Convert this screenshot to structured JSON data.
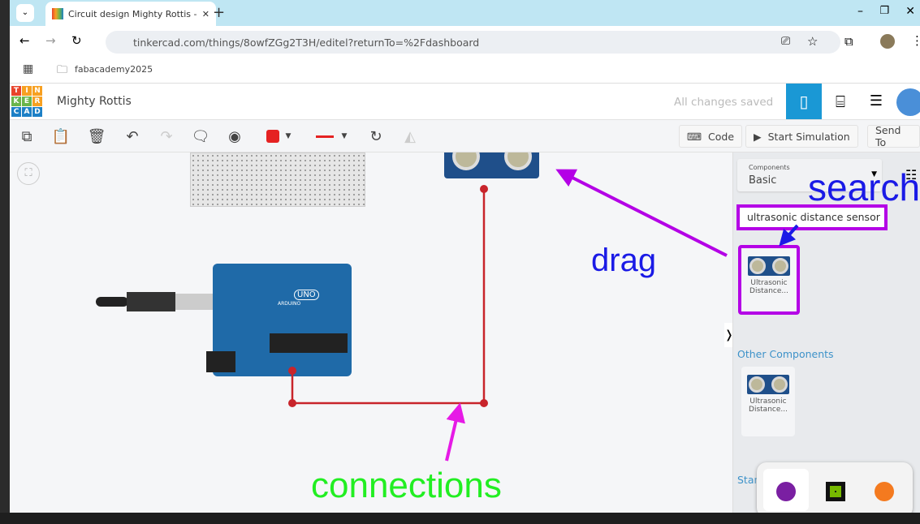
{
  "browser": {
    "tab_title": "Circuit design Mighty Rottis - Ti",
    "url": "tinkercad.com/things/8owfZGg2T3H/editel?returnTo=%2Fdashboard",
    "bookmark": "fabacademy2025"
  },
  "app": {
    "logo": [
      "T",
      "I",
      "N",
      "K",
      "E",
      "R",
      "C",
      "A",
      "D"
    ],
    "project_name": "Mighty Rottis",
    "save_status": "All changes saved"
  },
  "toolbar": {
    "code_label": "Code",
    "start_sim_label": "Start Simulation",
    "send_to_label": "Send To",
    "color": "#e52222"
  },
  "panel": {
    "components_label": "Components",
    "components_value": "Basic",
    "search_value": "ultrasonic distance sensor",
    "result_label_1": "Ultrasonic",
    "result_label_2": "Distance...",
    "other_heading": "Other Components",
    "other_label_1": "Ultrasonic",
    "other_label_2": "Distance...",
    "starter_heading": "Star"
  },
  "canvas": {
    "arduino_label": "UNO",
    "arduino_brand": "ARDUINO"
  },
  "annotations": {
    "search": "search",
    "drag": "drag",
    "connections": "connections",
    "highlight_color": "#b400e6"
  }
}
